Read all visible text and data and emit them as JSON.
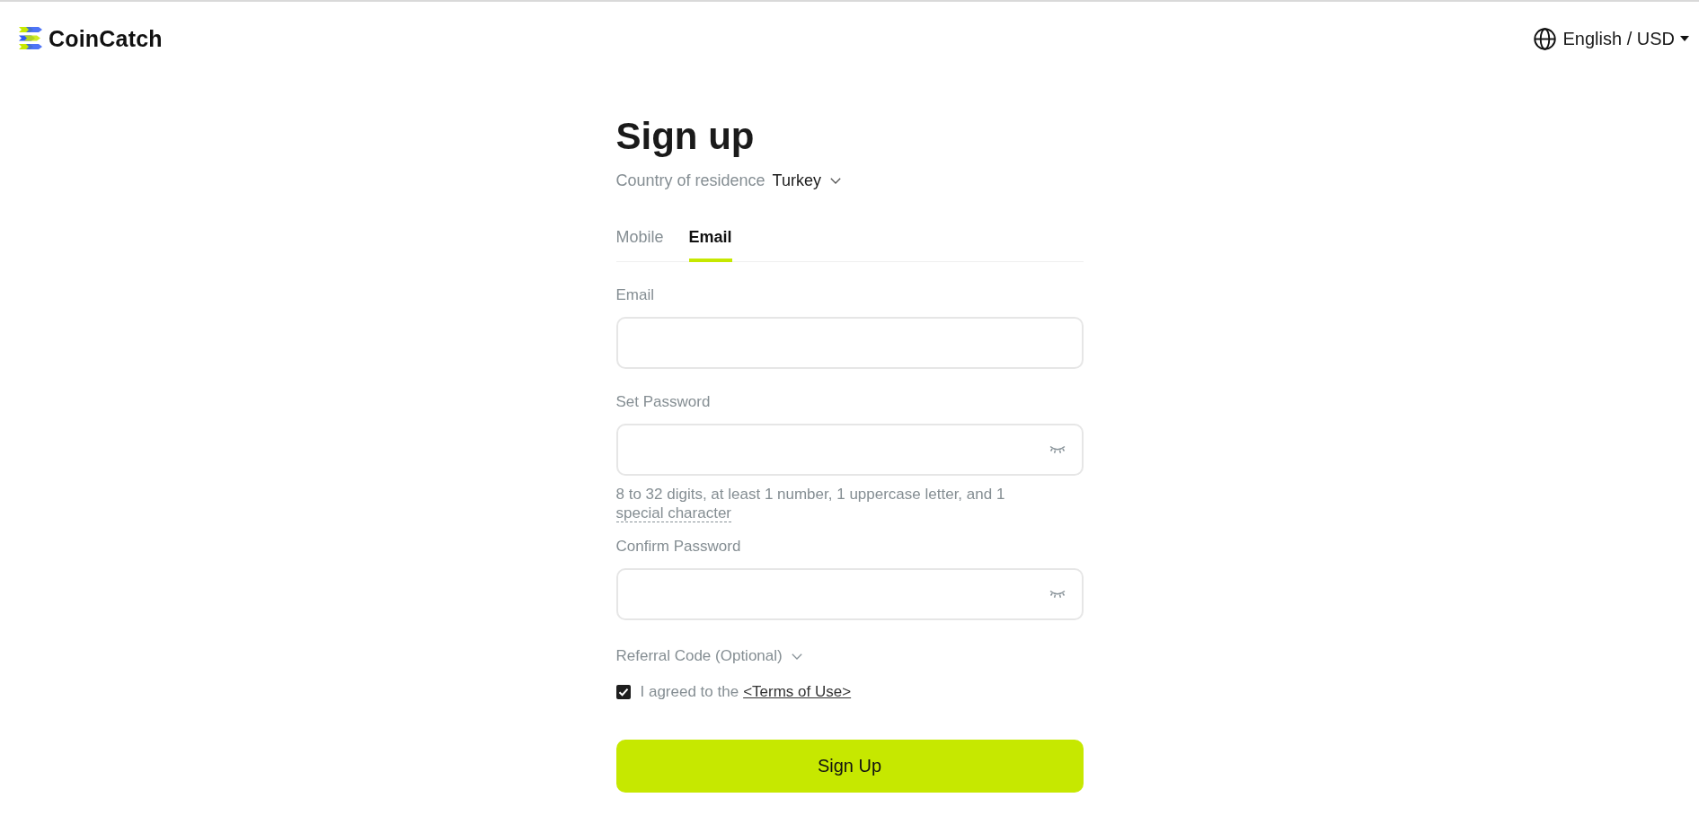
{
  "header": {
    "logo": "CoinCatch",
    "language": "English / USD"
  },
  "form": {
    "title": "Sign up",
    "country": {
      "label": "Country of residence",
      "value": "Turkey"
    },
    "tabs": [
      {
        "label": "Mobile",
        "selected": false
      },
      {
        "label": "Email",
        "selected": true
      }
    ],
    "fields": [
      {
        "kind": "text",
        "label": "Email"
      },
      {
        "kind": "password",
        "label": "Set Password",
        "hint": "8 to 32 digits, at least 1 number, 1 uppercase letter, and 1",
        "hint_term": "special character"
      },
      {
        "kind": "password",
        "label": "Confirm Password"
      }
    ],
    "referral": {
      "label": "Referral Code (Optional)",
      "expanded": false
    },
    "terms": {
      "text": "I agreed to the",
      "link": "<Terms of Use>",
      "checked": true
    },
    "submit": "Sign Up"
  }
}
